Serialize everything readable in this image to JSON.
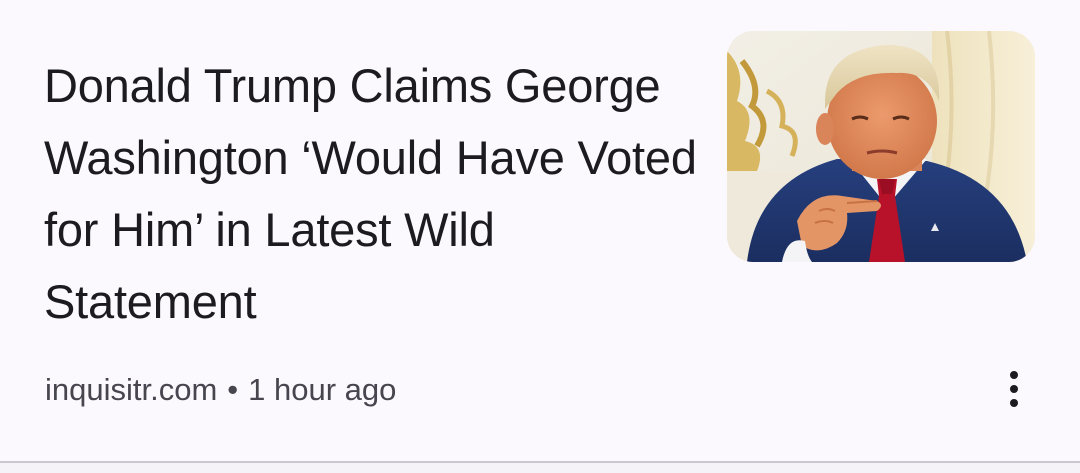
{
  "article": {
    "headline": "Donald Trump Claims George Washington ‘Would Have Voted for Him’ in Latest Wild Statement",
    "source": "inquisitr.com",
    "separator": "•",
    "time": "1 hour ago"
  },
  "icons": {
    "more": "more-vertical-icon"
  },
  "colors": {
    "background": "#fbf9fe",
    "text_primary": "#1c1b1f",
    "text_secondary": "#47464f",
    "divider": "#cac8d0"
  }
}
